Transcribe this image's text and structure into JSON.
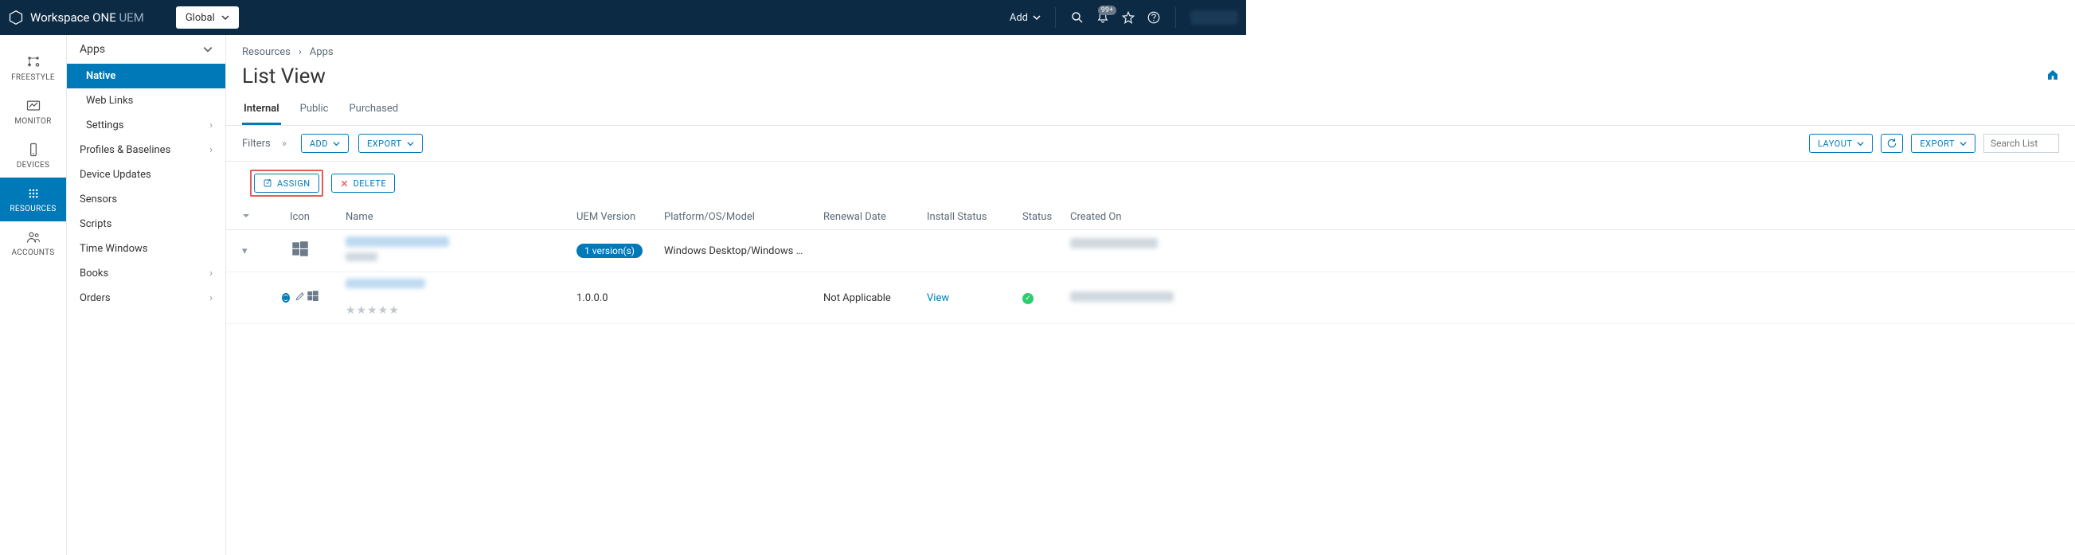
{
  "header": {
    "product": "Workspace ONE",
    "product_suffix": "UEM",
    "org_selector": "Global",
    "add_label": "Add",
    "notification_badge": "99+"
  },
  "rail": [
    {
      "id": "freestyle",
      "label": "FREESTYLE"
    },
    {
      "id": "monitor",
      "label": "MONITOR"
    },
    {
      "id": "devices",
      "label": "DEVICES"
    },
    {
      "id": "resources",
      "label": "RESOURCES",
      "active": true
    },
    {
      "id": "accounts",
      "label": "ACCOUNTS"
    }
  ],
  "sidebar": {
    "heading": "Apps",
    "items": [
      {
        "label": "Native",
        "selected": true
      },
      {
        "label": "Web Links"
      },
      {
        "label": "Settings",
        "chevron": true
      },
      {
        "label": "Profiles & Baselines",
        "chevron": true
      },
      {
        "label": "Device Updates"
      },
      {
        "label": "Sensors"
      },
      {
        "label": "Scripts"
      },
      {
        "label": "Time Windows"
      },
      {
        "label": "Books",
        "chevron": true
      },
      {
        "label": "Orders",
        "chevron": true
      }
    ]
  },
  "breadcrumb": {
    "root": "Resources",
    "leaf": "Apps"
  },
  "page_title": "List View",
  "tabs": [
    {
      "label": "Internal",
      "active": true
    },
    {
      "label": "Public"
    },
    {
      "label": "Purchased"
    }
  ],
  "toolbar": {
    "filters_label": "Filters",
    "add": "ADD",
    "export_left": "EXPORT",
    "layout": "LAYOUT",
    "export_right": "EXPORT",
    "search_placeholder": "Search List"
  },
  "selection_actions": {
    "assign": "ASSIGN",
    "delete": "DELETE"
  },
  "columns": {
    "icon": "Icon",
    "name": "Name",
    "uem_version": "UEM Version",
    "platform": "Platform/OS/Model",
    "renewal": "Renewal Date",
    "install": "Install Status",
    "status": "Status",
    "created": "Created On"
  },
  "rows": [
    {
      "kind": "group",
      "name": "██████ █████ ██",
      "name_sub": "████",
      "uem_version_badge": "1 version(s)",
      "platform": "Windows Desktop/Windows …",
      "created": "██████ ████ ██"
    },
    {
      "kind": "item",
      "selected": true,
      "name": "██████ █████ ██",
      "uem_version": "1.0.0.0",
      "renewal": "Not Applicable",
      "install": "View",
      "status": "ok",
      "created": "██████ ████ ██"
    }
  ]
}
